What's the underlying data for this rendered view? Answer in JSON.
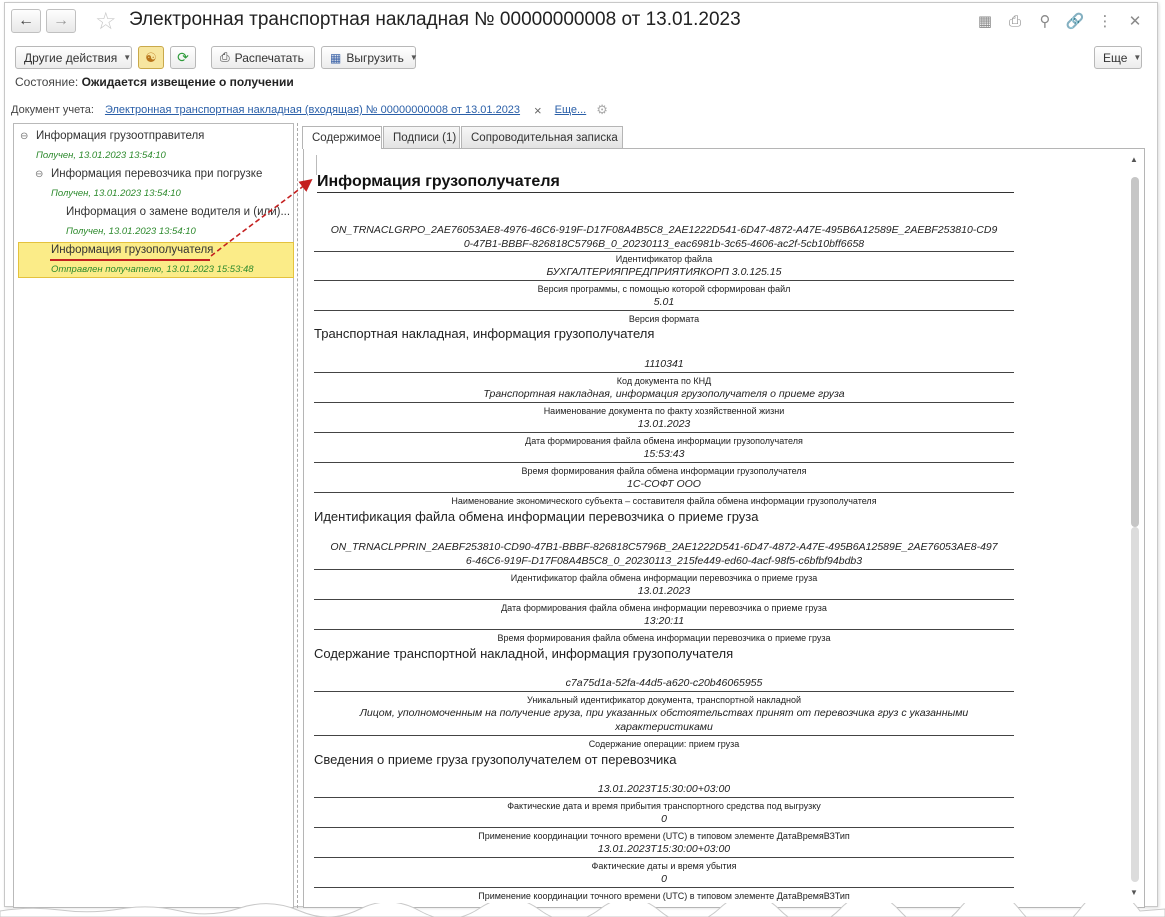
{
  "window": {
    "title": "Электронная транспортная накладная № 00000000008 от 13.01.2023"
  },
  "toolbar": {
    "other_actions": "Другие действия",
    "print": "Распечатать",
    "export": "Выгрузить",
    "more": "Еще"
  },
  "state": {
    "label": "Состояние:",
    "value": "Ожидается извещение о получении"
  },
  "doc_account": {
    "label": "Документ учета:",
    "link": "Электронная транспортная накладная (входящая) № 00000000008 от 13.01.2023",
    "clear": "×",
    "more": "Еще..."
  },
  "tree": [
    {
      "label": "Информация грузоотправителя",
      "status": "Получен, 13.01.2023 13:54:10"
    },
    {
      "label": "Информация перевозчика при погрузке",
      "status": "Получен, 13.01.2023 13:54:10"
    },
    {
      "label": "Информация о замене водителя и (или)...",
      "status": "Получен, 13.01.2023 13:54:10"
    },
    {
      "label": "Информация грузополучателя",
      "status": "Отправлен получателю, 13.01.2023 15:53:48"
    }
  ],
  "tabs": [
    "Содержимое",
    "Подписи (1)",
    "Сопроводительная записка"
  ],
  "document": {
    "title": "Информация грузополучателя",
    "file_id_line1": "ON_TRNACLGRPO_2AE76053AE8-4976-46C6-919F-D17F08A4B5C8_2AE1222D541-6D47-4872-A47E-495B6A12589E_2AEBF253810-CD9",
    "file_id_line2": "0-47B1-BBBF-826818C5796B_0_20230113_eac6981b-3c65-4606-ac2f-5cb10bff6658",
    "file_id_caption": "Идентификатор файла",
    "program": "БУХГАЛТЕРИЯПРЕДПРИЯТИЯКОРП 3.0.125.15",
    "program_caption": "Версия программы, с помощью которой сформирован файл",
    "format": "5.01",
    "format_caption": "Версия формата",
    "section1": "Транспортная накладная, информация грузополучателя",
    "knd": "1110341",
    "knd_caption": "Код документа по КНД",
    "docname": "Транспортная накладная, информация грузополучателя о приеме груза",
    "docname_caption": "Наименование документа по факту хозяйственной жизни",
    "date": "13.01.2023",
    "date_caption": "Дата формирования файла обмена информации грузополучателя",
    "time": "15:53:43",
    "time_caption": "Время формирования файла обмена информации грузополучателя",
    "org": "1С-СОФТ ООО",
    "org_caption": "Наименование экономического субъекта – составителя файла обмена информации грузополучателя",
    "section2": "Идентификация файла обмена информации перевозчика о приеме груза",
    "carrier_id_line1": "ON_TRNACLPPRIN_2AEBF253810-CD90-47B1-BBBF-826818C5796B_2AE1222D541-6D47-4872-A47E-495B6A12589E_2AE76053AE8-497",
    "carrier_id_line2": "6-46C6-919F-D17F08A4B5C8_0_20230113_215fe449-ed60-4acf-98f5-c6bfbf94bdb3",
    "carrier_id_caption": "Идентификатор файла обмена информации перевозчика о приеме груза",
    "carrier_date": "13.01.2023",
    "carrier_date_caption": "Дата формирования файла обмена информации перевозчика о приеме груза",
    "carrier_time": "13:20:11",
    "carrier_time_caption": "Время формирования файла обмена информации перевозчика о приеме груза",
    "section3": "Содержание транспортной накладной, информация грузополучателя",
    "uid": "c7a75d1a-52fa-44d5-a620-c20b46065955",
    "uid_caption": "Уникальный идентификатор документа, транспортной накладной",
    "operation_line1": "Лицом, уполномоченным на получение груза, при указанных обстоятельствах принят от перевозчика груз с указанными",
    "operation_line2": "характеристиками",
    "operation_caption": "Содержание операции: прием груза",
    "section4": "Сведения о приеме груза грузополучателем от перевозчика",
    "arrival": "13.01.2023T15:30:00+03:00",
    "arrival_caption": "Фактические дата и время прибытия транспортного средства под выгрузку",
    "utc1": "0",
    "utc1_caption": "Применение координации точного времени (UTC) в типовом элементе ДатаВремяВЗТип",
    "departure": "13.01.2023T15:30:00+03:00",
    "departure_caption": "Фактические даты и время убытия",
    "utc2": "0",
    "utc2_caption": "Применение координации точного времени (UTC) в типовом элементе ДатаВремяВЗТип"
  }
}
